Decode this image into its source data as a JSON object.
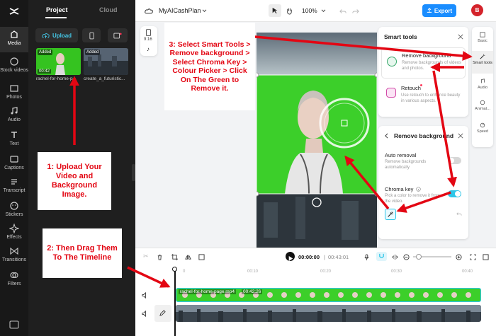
{
  "rail": {
    "items": [
      {
        "label": "Media"
      },
      {
        "label": "Stock videos"
      },
      {
        "label": "Photos"
      },
      {
        "label": "Audio"
      },
      {
        "label": "Text"
      },
      {
        "label": "Captions"
      },
      {
        "label": "Transcript"
      },
      {
        "label": "Stickers"
      },
      {
        "label": "Effects"
      },
      {
        "label": "Transitions"
      },
      {
        "label": "Filters"
      }
    ]
  },
  "panel": {
    "tab_project": "Project",
    "tab_cloud": "Cloud",
    "upload_label": "Upload",
    "media": [
      {
        "added": "Added",
        "duration": "00:42",
        "name": "rachel-for-home-p..."
      },
      {
        "added": "Added",
        "duration": "",
        "name": "create_a_futuristic..."
      }
    ]
  },
  "topbar": {
    "project_name": "MyAICashPlan",
    "zoom": "100%",
    "export_label": "Export",
    "avatar_letter": "B"
  },
  "canvas": {
    "ratio_label": "9:16"
  },
  "smart_tools": {
    "title": "Smart tools",
    "remove_bg_title": "Remove background",
    "remove_bg_desc": "Remove backgrounds of videos and photos.",
    "retouch_title": "Retouch",
    "retouch_desc": "Use retouch to enhance beauty in various aspects."
  },
  "remove_bg_panel": {
    "title": "Remove background",
    "auto_title": "Auto removal",
    "auto_desc": "Remove backgrounds automatically",
    "chroma_title": "Chroma key",
    "chroma_desc": "Pick a color to remove it from the video."
  },
  "right_rail": [
    {
      "label": "Basic"
    },
    {
      "label": "Smart tools"
    },
    {
      "label": "Audio"
    },
    {
      "label": "Animat..."
    },
    {
      "label": "Speed"
    }
  ],
  "timeline": {
    "current": "00:00:00",
    "total": "00:43:01",
    "ticks": [
      "0",
      "00:10",
      "00:20",
      "00:30",
      "00:40"
    ],
    "clip_name": "rachel-for-home-page.mp4",
    "clip_duration": "00:42:26"
  },
  "notes": {
    "n1": "1: Upload Your Video and Background Image.",
    "n2": "2: Then Drag Them To The Timeline",
    "n3": "3: Select Smart Tools > Remove background > Select Chroma Key > Colour Picker > Click On The Green to Remove it."
  },
  "colors": {
    "accent": "#1a8dff",
    "teal": "#2fc6e8",
    "green_screen": "#3ccf2a",
    "annotation": "#e30613"
  }
}
